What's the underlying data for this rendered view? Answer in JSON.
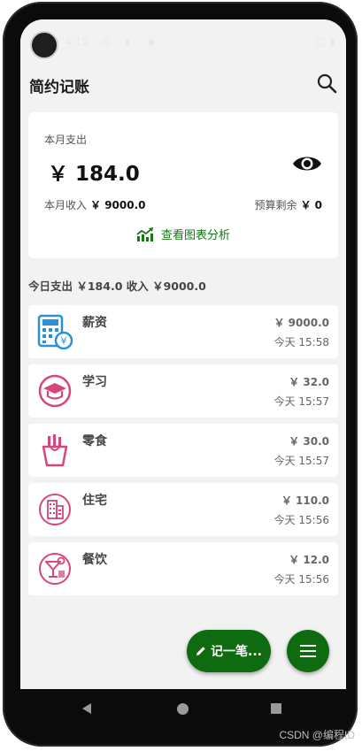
{
  "statusbar": {
    "time": "4:15",
    "icons": "⊙ ◐ ▪",
    "right": "◫ ▮"
  },
  "app": {
    "title": "简约记账"
  },
  "summary": {
    "label": "本月支出",
    "amount": "￥ 184.0",
    "income_label": "本月收入",
    "income_value": "￥ 9000.0",
    "budget_label": "预算剩余",
    "budget_value": "￥ 0",
    "chart_link": "查看图表分析"
  },
  "today": {
    "summary": "今日支出 ￥184.0 收入 ￥9000.0"
  },
  "records": [
    {
      "name": "薪资",
      "amount": "￥ 9000.0",
      "time": "今天 15:58",
      "icon": "calculator-icon"
    },
    {
      "name": "学习",
      "amount": "￥ 32.0",
      "time": "今天 15:57",
      "icon": "graduation-cap-icon"
    },
    {
      "name": "零食",
      "amount": "￥ 30.0",
      "time": "今天 15:57",
      "icon": "fries-icon"
    },
    {
      "name": "住宅",
      "amount": "￥ 110.0",
      "time": "今天 15:56",
      "icon": "building-icon"
    },
    {
      "name": "餐饮",
      "amount": "￥ 12.0",
      "time": "今天 15:56",
      "icon": "cocktail-icon"
    }
  ],
  "fab": {
    "record_label": "记一笔..."
  },
  "watermark": "CSDN @编程ID",
  "colors": {
    "accent": "#0f6b0f",
    "income_icon": "#2a90d8",
    "expense_icon": "#d6467a"
  }
}
